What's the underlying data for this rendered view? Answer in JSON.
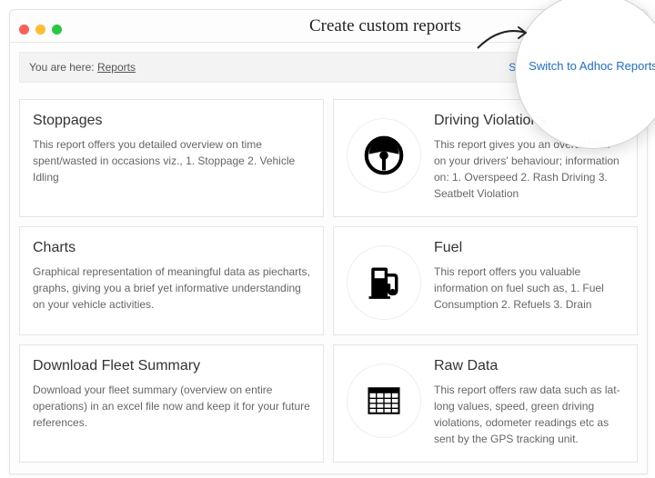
{
  "callout_text": "Create custom reports",
  "breadcrumb": {
    "prefix": "You are here: ",
    "link": "Reports"
  },
  "switch_link": "Switch to Adhoc Reports",
  "magnifier_link": "Switch to Adhoc Reports",
  "cards": {
    "stoppages": {
      "title": "Stoppages",
      "desc": "This report offers you detailed overview on time spent/wasted in occasions viz., 1. Stoppage 2. Vehicle Idling"
    },
    "driving_violations": {
      "title": "Driving Violations",
      "desc": "This report gives you an overall idea on your drivers' behaviour; information on: 1. Overspeed 2. Rash Driving 3. Seatbelt Violation",
      "icon": "steering-wheel-icon"
    },
    "charts": {
      "title": "Charts",
      "desc": "Graphical representation of meaningful data as piecharts, graphs, giving you a brief yet informative understanding on your vehicle activities."
    },
    "fuel": {
      "title": "Fuel",
      "desc": "This report offers you valuable information on fuel such as, 1. Fuel Consumption 2. Refuels 3. Drain",
      "icon": "fuel-pump-icon"
    },
    "download_fleet": {
      "title": "Download Fleet Summary",
      "desc": "Download your fleet summary (overview on entire operations) in an excel file now and keep it for your future references."
    },
    "raw_data": {
      "title": "Raw Data",
      "desc": "This report offers raw data such as lat-long values, speed, green driving violations, odometer readings etc as sent by the GPS tracking unit.",
      "icon": "data-table-icon"
    }
  }
}
